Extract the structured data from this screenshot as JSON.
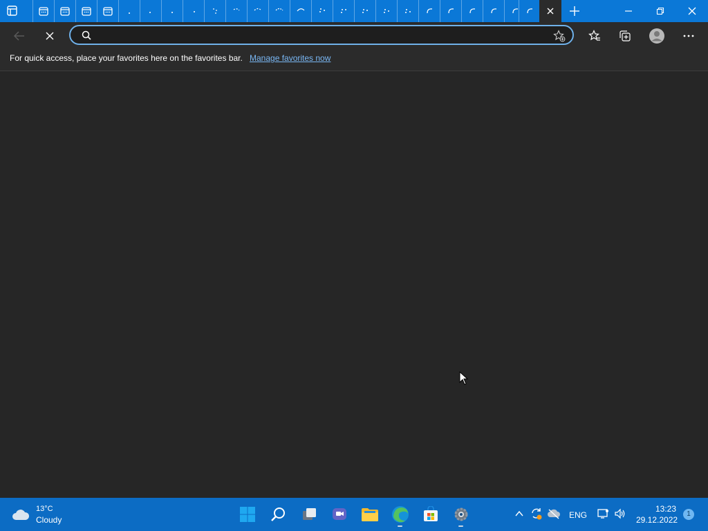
{
  "browser": {
    "address_value": "",
    "address_placeholder": "",
    "favorites_bar_message": "For quick access, place your favorites here on the favorites bar.",
    "favorites_bar_link": "Manage favorites now"
  },
  "taskbar": {
    "weather_temp": "13°C",
    "weather_condition": "Cloudy",
    "language": "ENG",
    "time": "13:23",
    "date": "29.12.2022",
    "notification_count": "1"
  },
  "colors": {
    "titlebar": "#0b78d7",
    "taskbar": "#0c6cc4",
    "content": "#262626",
    "link": "#7ab8f5"
  }
}
